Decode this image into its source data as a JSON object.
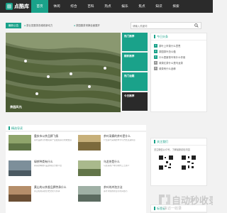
{
  "header": {
    "logo_text": "点酷库",
    "nav": [
      {
        "label": "首页"
      },
      {
        "label": "休闲"
      },
      {
        "label": "综合"
      },
      {
        "label": "百科"
      },
      {
        "label": "热点"
      },
      {
        "label": "娱乐"
      },
      {
        "label": "焦点"
      },
      {
        "label": "知识"
      },
      {
        "label": "探索"
      }
    ],
    "brand_color": "#1aa28a"
  },
  "notice": {
    "tag": "最新公告",
    "items": [
      "茶业发展茶农增收新动力",
      "茶园春茶采摘全面展开"
    ]
  },
  "search": {
    "placeholder": "请输入关键词"
  },
  "hero": {
    "caption": "茶园风光"
  },
  "tiles": [
    {
      "label": "热门推荐"
    },
    {
      "label": "精彩推荐"
    },
    {
      "label": "热门话题"
    },
    {
      "label": "今日推荐"
    }
  ],
  "today": {
    "title": "今日头条",
    "items": [
      "茶叶上市茶什么意思",
      "茶园茶叶怎么做",
      "什么是新茶叶有什么作用",
      "绿茶红茶什么是乌龙茶",
      "绿茶有什么品种"
    ]
  },
  "articles": {
    "section_title": "精选导读",
    "items": [
      {
        "title": "重庆市以茶品牌飞扬",
        "desc": "茶叶品牌宣传推动茶产业发展茶农增收致富"
      },
      {
        "title": "茶叶采摘的茶叶是什么",
        "desc": "介绍茶叶采摘的季节与方式及其特点"
      },
      {
        "title": "绿茶种类有什么",
        "desc": "绿茶的种类与品质特点分类介绍"
      },
      {
        "title": "乌龙茶是什么",
        "desc": "乌龙茶的产地与制作工艺简介"
      },
      {
        "title": "黄山的以茶香品牌传承什么",
        "desc": "黄山毛峰茶的历史文化与传承"
      },
      {
        "title": "茶叶的冲泡方法",
        "desc": "茶叶冲泡的水温与时间技巧"
      }
    ]
  },
  "follow": {
    "title": "关注我们",
    "text": "关注微信公众号，了解最新精彩内容"
  },
  "watermark": {
    "main": "自动秒收录",
    "sub": "一来访一收录"
  },
  "tags": {
    "title": "标签云"
  }
}
